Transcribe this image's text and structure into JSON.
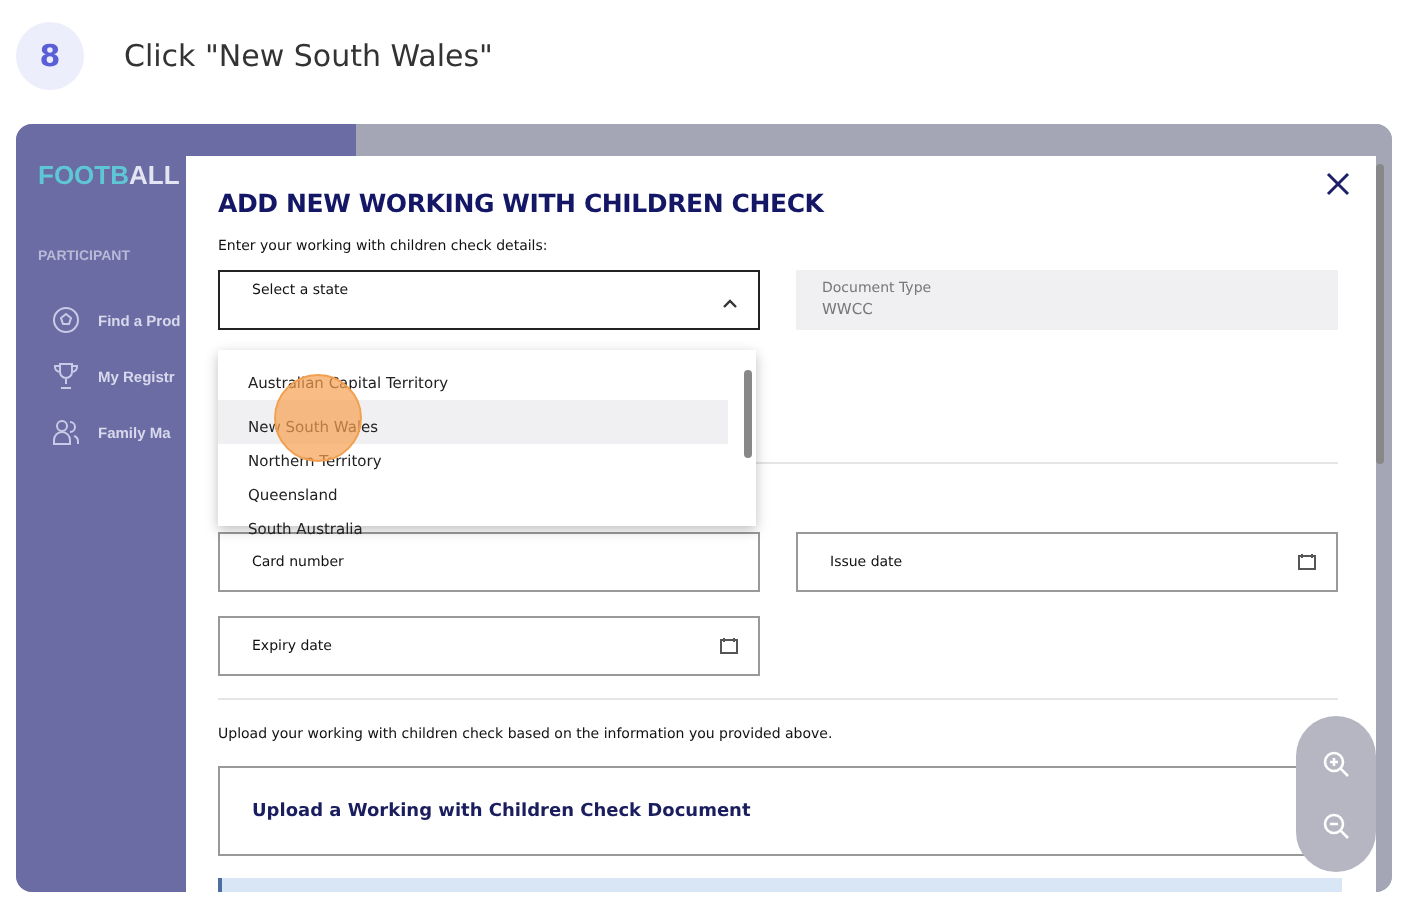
{
  "step": {
    "number": "8",
    "instruction": "Click \"New South Wales\""
  },
  "sidebar": {
    "logo_part_1": "FOOTB",
    "logo_part_2": "ALL",
    "section": "PARTICIPANT",
    "items": [
      {
        "label": "Find a Prod"
      },
      {
        "label": "My Registr"
      },
      {
        "label": "Family Ma"
      }
    ]
  },
  "modal": {
    "title": "ADD NEW WORKING WITH CHILDREN CHECK",
    "intro": "Enter your working with children check details:",
    "state_select": {
      "label": "Select a state",
      "expanded": true
    },
    "document_type": {
      "label": "Document Type",
      "value": "WWCC"
    },
    "options": [
      {
        "label": "Australian Capital Territory",
        "selected": false
      },
      {
        "label": "New South Wales",
        "selected": true
      },
      {
        "label": "Northern Territory",
        "selected": false
      },
      {
        "label": "Queensland",
        "selected": false
      },
      {
        "label": "South Australia",
        "selected": false
      }
    ],
    "card_number": {
      "placeholder": "Card number"
    },
    "issue_date": {
      "placeholder": "Issue date"
    },
    "expiry_date": {
      "placeholder": "Expiry date"
    },
    "upload_intro": "Upload your working with children check based on the information you provided above.",
    "upload_title": "Upload a Working with Children Check Document"
  }
}
